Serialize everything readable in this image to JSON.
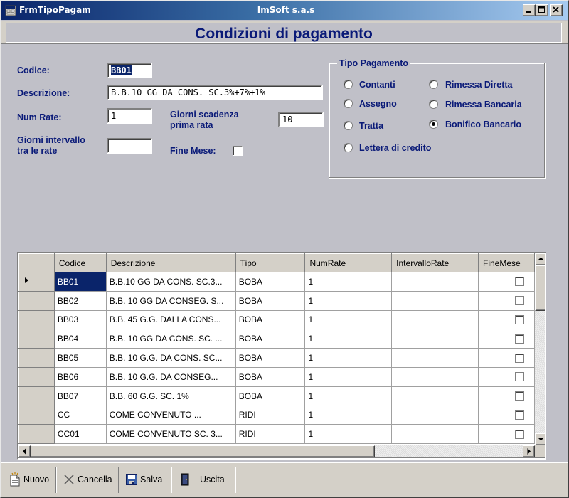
{
  "window": {
    "title": "FrmTipoPagam",
    "center_title": "ImSoft s.a.s"
  },
  "header": {
    "title": "Condizioni di pagamento"
  },
  "form": {
    "codice_label": "Codice:",
    "codice_value": "BB01",
    "descrizione_label": "Descrizione:",
    "descrizione_value": "B.B.10 GG DA CONS. SC.3%+7%+1%",
    "num_rate_label": "Num Rate:",
    "num_rate_value": "1",
    "giorni_scadenza_label_1": "Giorni scadenza",
    "giorni_scadenza_label_2": "prima rata",
    "giorni_scadenza_value": "10",
    "giorni_intervallo_label_1": "Giorni intervallo",
    "giorni_intervallo_label_2": "tra le rate",
    "giorni_intervallo_value": "",
    "fine_mese_label": "Fine Mese:",
    "fine_mese_checked": false
  },
  "tipo_pagamento": {
    "legend": "Tipo Pagamento",
    "options": [
      {
        "label": "Contanti",
        "checked": false
      },
      {
        "label": "Assegno",
        "checked": false
      },
      {
        "label": "Tratta",
        "checked": false
      },
      {
        "label": "Lettera di credito",
        "checked": false
      },
      {
        "label": "Rimessa Diretta",
        "checked": false
      },
      {
        "label": "Rimessa Bancaria",
        "checked": false
      },
      {
        "label": "Bonifico Bancario",
        "checked": true
      }
    ]
  },
  "grid": {
    "columns": [
      "Codice",
      "Descrizione",
      "Tipo",
      "NumRate",
      "IntervalloRate",
      "FineMese"
    ],
    "current_row": 0,
    "rows": [
      {
        "codice": "BB01",
        "descrizione": "B.B.10 GG DA CONS. SC.3...",
        "tipo": "BOBA",
        "numrate": "1",
        "intervallo": "",
        "finemese": false
      },
      {
        "codice": "BB02",
        "descrizione": "B.B. 10 GG DA CONSEG. S...",
        "tipo": "BOBA",
        "numrate": "1",
        "intervallo": "",
        "finemese": false
      },
      {
        "codice": "BB03",
        "descrizione": "B.B. 45 G.G. DALLA CONS...",
        "tipo": "BOBA",
        "numrate": "1",
        "intervallo": "",
        "finemese": false
      },
      {
        "codice": "BB04",
        "descrizione": "B.B. 10 GG DA CONS. SC. ...",
        "tipo": "BOBA",
        "numrate": "1",
        "intervallo": "",
        "finemese": false
      },
      {
        "codice": "BB05",
        "descrizione": "B.B. 10 G.G. DA CONS. SC...",
        "tipo": "BOBA",
        "numrate": "1",
        "intervallo": "",
        "finemese": false
      },
      {
        "codice": "BB06",
        "descrizione": "B.B. 10 G.G. DA CONSEG...",
        "tipo": "BOBA",
        "numrate": "1",
        "intervallo": "",
        "finemese": false
      },
      {
        "codice": "BB07",
        "descrizione": "B.B. 60 G.G. SC. 1%",
        "tipo": "BOBA",
        "numrate": "1",
        "intervallo": "",
        "finemese": false
      },
      {
        "codice": "CC",
        "descrizione": "COME CONVENUTO        ...",
        "tipo": "RIDI",
        "numrate": "1",
        "intervallo": "",
        "finemese": false
      },
      {
        "codice": "CC01",
        "descrizione": "COME CONVENUTO SC. 3...",
        "tipo": "RIDI",
        "numrate": "1",
        "intervallo": "",
        "finemese": false
      }
    ]
  },
  "toolbar": {
    "nuovo": "Nuovo",
    "cancella": "Cancella",
    "salva": "Salva",
    "uscita": "Uscita"
  },
  "icons": [
    "app-icon",
    "minimize-icon",
    "maximize-icon",
    "close-icon",
    "new-document-icon",
    "delete-x-icon",
    "save-disk-icon",
    "exit-door-icon",
    "row-pointer-icon",
    "arrow-up-icon",
    "arrow-down-icon",
    "arrow-left-icon",
    "arrow-right-icon"
  ]
}
